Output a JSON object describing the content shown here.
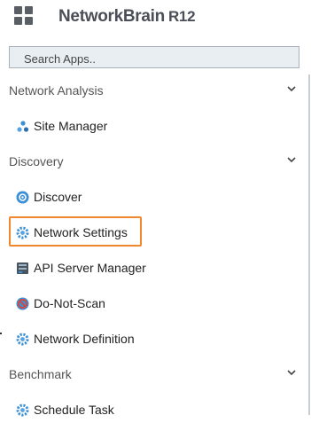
{
  "header": {
    "brand": "NetworkBrain",
    "version": "R12"
  },
  "search": {
    "placeholder": "Search Apps.."
  },
  "sections": [
    {
      "label": "Network Analysis",
      "items": [
        {
          "label": "Site Manager",
          "icon": "site-manager-icon"
        }
      ]
    },
    {
      "label": "Discovery",
      "items": [
        {
          "label": "Discover",
          "icon": "discover-icon"
        },
        {
          "label": "Network Settings",
          "icon": "network-settings-icon"
        },
        {
          "label": "API Server Manager",
          "icon": "api-server-icon"
        },
        {
          "label": "Do-Not-Scan",
          "icon": "do-not-scan-icon"
        },
        {
          "label": "Network Definition",
          "icon": "network-definition-icon"
        }
      ]
    },
    {
      "label": "Benchmark",
      "items": [
        {
          "label": "Schedule Task",
          "icon": "schedule-task-icon"
        }
      ]
    }
  ],
  "colors": {
    "highlight": "#f0872c",
    "icon_blue": "#3a8fd6",
    "icon_red": "#d9473b"
  }
}
